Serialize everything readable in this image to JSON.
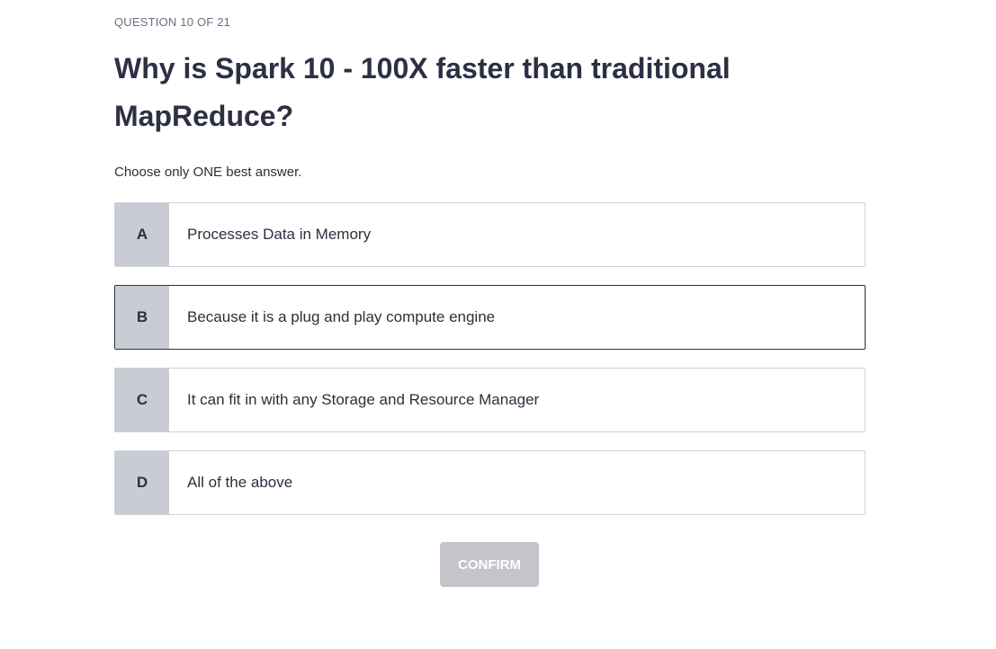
{
  "question_counter": "QUESTION 10 OF 21",
  "question": "Why is Spark 10 - 100X faster than traditional MapReduce?",
  "instruction": "Choose only ONE best answer.",
  "options": [
    {
      "letter": "A",
      "text": "Processes Data in Memory"
    },
    {
      "letter": "B",
      "text": "Because it is a plug and play compute engine"
    },
    {
      "letter": "C",
      "text": "It can fit in with any Storage and Resource Manager"
    },
    {
      "letter": "D",
      "text": "All of the above"
    }
  ],
  "confirm_label": "CONFIRM"
}
